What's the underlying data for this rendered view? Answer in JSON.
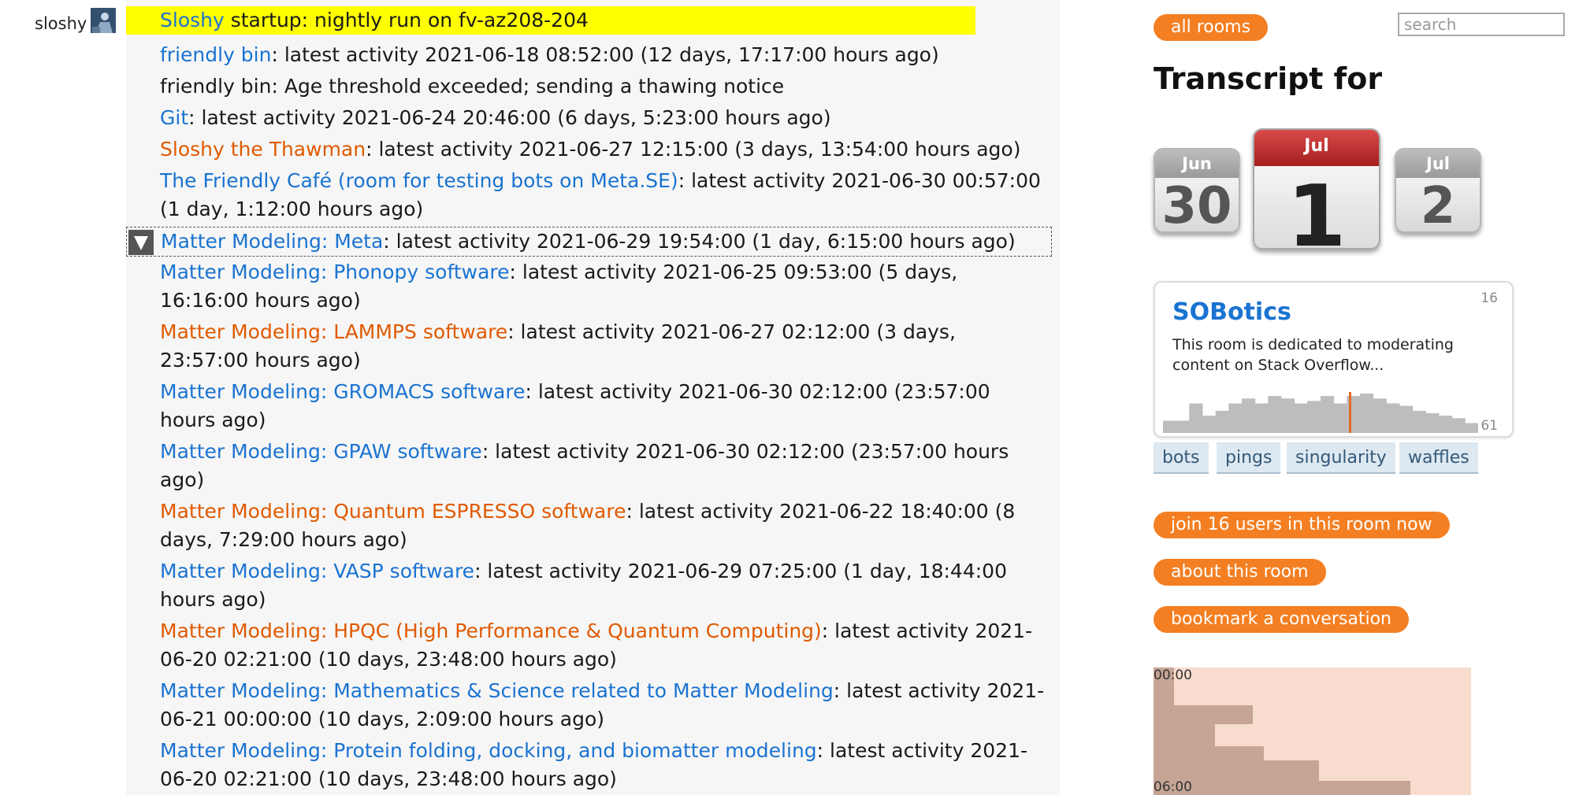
{
  "user": {
    "name": "sloshy"
  },
  "messages": [
    {
      "link": "Sloshy",
      "link_color": "blue",
      "text": " startup: nightly run on fv-az208-204",
      "highlight": true
    },
    {
      "link": "friendly bin",
      "link_color": "blue",
      "text": ": latest activity 2021-06-18 08:52:00 (12 days, 17:17:00 hours ago)"
    },
    {
      "link": "",
      "link_color": "",
      "text": "friendly bin: Age threshold exceeded; sending a thawing notice"
    },
    {
      "link": "Git",
      "link_color": "blue",
      "text": ": latest activity 2021-06-24 20:46:00 (6 days, 5:23:00 hours ago)"
    },
    {
      "link": "Sloshy the Thawman",
      "link_color": "orange",
      "text": ": latest activity 2021-06-27 12:15:00 (3 days, 13:54:00 hours ago)"
    },
    {
      "link": "The Friendly Café (room for testing bots on Meta.SE)",
      "link_color": "blue",
      "text": ": latest activity 2021-06-30 00:57:00 (1 day, 1:12:00 hours ago)"
    },
    {
      "link": "Matter Modeling: Meta",
      "link_color": "blue",
      "text": ": latest activity 2021-06-29 19:54:00 (1 day, 6:15:00 hours ago)",
      "hover": true
    },
    {
      "link": "Matter Modeling: Phonopy software",
      "link_color": "blue",
      "text": ": latest activity 2021-06-25 09:53:00 (5 days, 16:16:00 hours ago)"
    },
    {
      "link": "Matter Modeling: LAMMPS software",
      "link_color": "orange",
      "text": ": latest activity 2021-06-27 02:12:00 (3 days, 23:57:00 hours ago)"
    },
    {
      "link": "Matter Modeling: GROMACS software",
      "link_color": "blue",
      "text": ": latest activity 2021-06-30 02:12:00 (23:57:00 hours ago)"
    },
    {
      "link": "Matter Modeling: GPAW software",
      "link_color": "blue",
      "text": ": latest activity 2021-06-30 02:12:00 (23:57:00 hours ago)"
    },
    {
      "link": "Matter Modeling: Quantum ESPRESSO software",
      "link_color": "orange",
      "text": ": latest activity 2021-06-22 18:40:00 (8 days, 7:29:00 hours ago)"
    },
    {
      "link": "Matter Modeling: VASP software",
      "link_color": "blue",
      "text": ": latest activity 2021-06-29 07:25:00 (1 day, 18:44:00 hours ago)"
    },
    {
      "link": "Matter Modeling: HPQC (High Performance & Quantum Computing)",
      "link_color": "orange",
      "text": ": latest activity 2021-06-20 02:21:00 (10 days, 23:48:00 hours ago)"
    },
    {
      "link": "Matter Modeling: Mathematics & Science related to Matter Modeling",
      "link_color": "blue",
      "text": ": latest activity 2021-06-21 00:00:00 (10 days, 2:09:00 hours ago)"
    },
    {
      "link": "Matter Modeling: Protein folding, docking, and biomatter modeling",
      "link_color": "blue",
      "text": ": latest activity 2021-06-20 02:21:00 (10 days, 23:48:00 hours ago)"
    }
  ],
  "sidebar": {
    "all_rooms": "all rooms",
    "search_placeholder": "search",
    "heading": "Transcript for",
    "calendar": {
      "prev": {
        "month": "Jun",
        "day": "30"
      },
      "current": {
        "month": "Jul",
        "day": "1"
      },
      "next": {
        "month": "Jul",
        "day": "2"
      }
    },
    "room": {
      "name": "SOBotics",
      "user_count": "16",
      "description": "This room is dedicated to moderating content on Stack Overflow...",
      "message_count": "61",
      "activity": [
        10,
        10,
        24,
        14,
        18,
        24,
        28,
        24,
        30,
        28,
        24,
        26,
        30,
        24,
        30,
        32,
        28,
        24,
        22,
        18,
        16,
        14,
        12,
        8
      ]
    },
    "tags": [
      "bots",
      "pings",
      "singularity",
      "waffles"
    ],
    "actions": {
      "join": "join 16 users in this room now",
      "about": "about this room",
      "bookmark": "bookmark a conversation"
    },
    "time_labels": [
      "00:00",
      "06:00"
    ],
    "colors": {
      "accent": "#f47f22",
      "link_blue": "#1a73d1",
      "link_orange": "#e05a00",
      "highlight": "#ffff00"
    }
  }
}
